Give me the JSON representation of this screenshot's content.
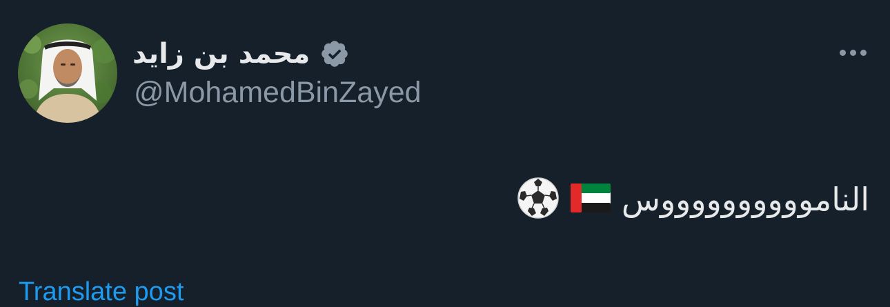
{
  "author": {
    "display_name": "محمد بن زايد",
    "handle": "@MohamedBinZayed",
    "avatar_icon": "profile-photo",
    "verified_icon": "verified-badge-icon"
  },
  "post": {
    "text": "النامووووووووووس",
    "emojis": [
      "uae-flag-icon",
      "soccer-ball-icon"
    ]
  },
  "actions": {
    "more_icon": "more-options-icon",
    "translate_label": "Translate post"
  },
  "colors": {
    "background": "#15202b",
    "primary_text": "#e7e9ea",
    "secondary_text": "#8b98a5",
    "link": "#1d9bf0",
    "verified_badge": "#8b98a5"
  }
}
